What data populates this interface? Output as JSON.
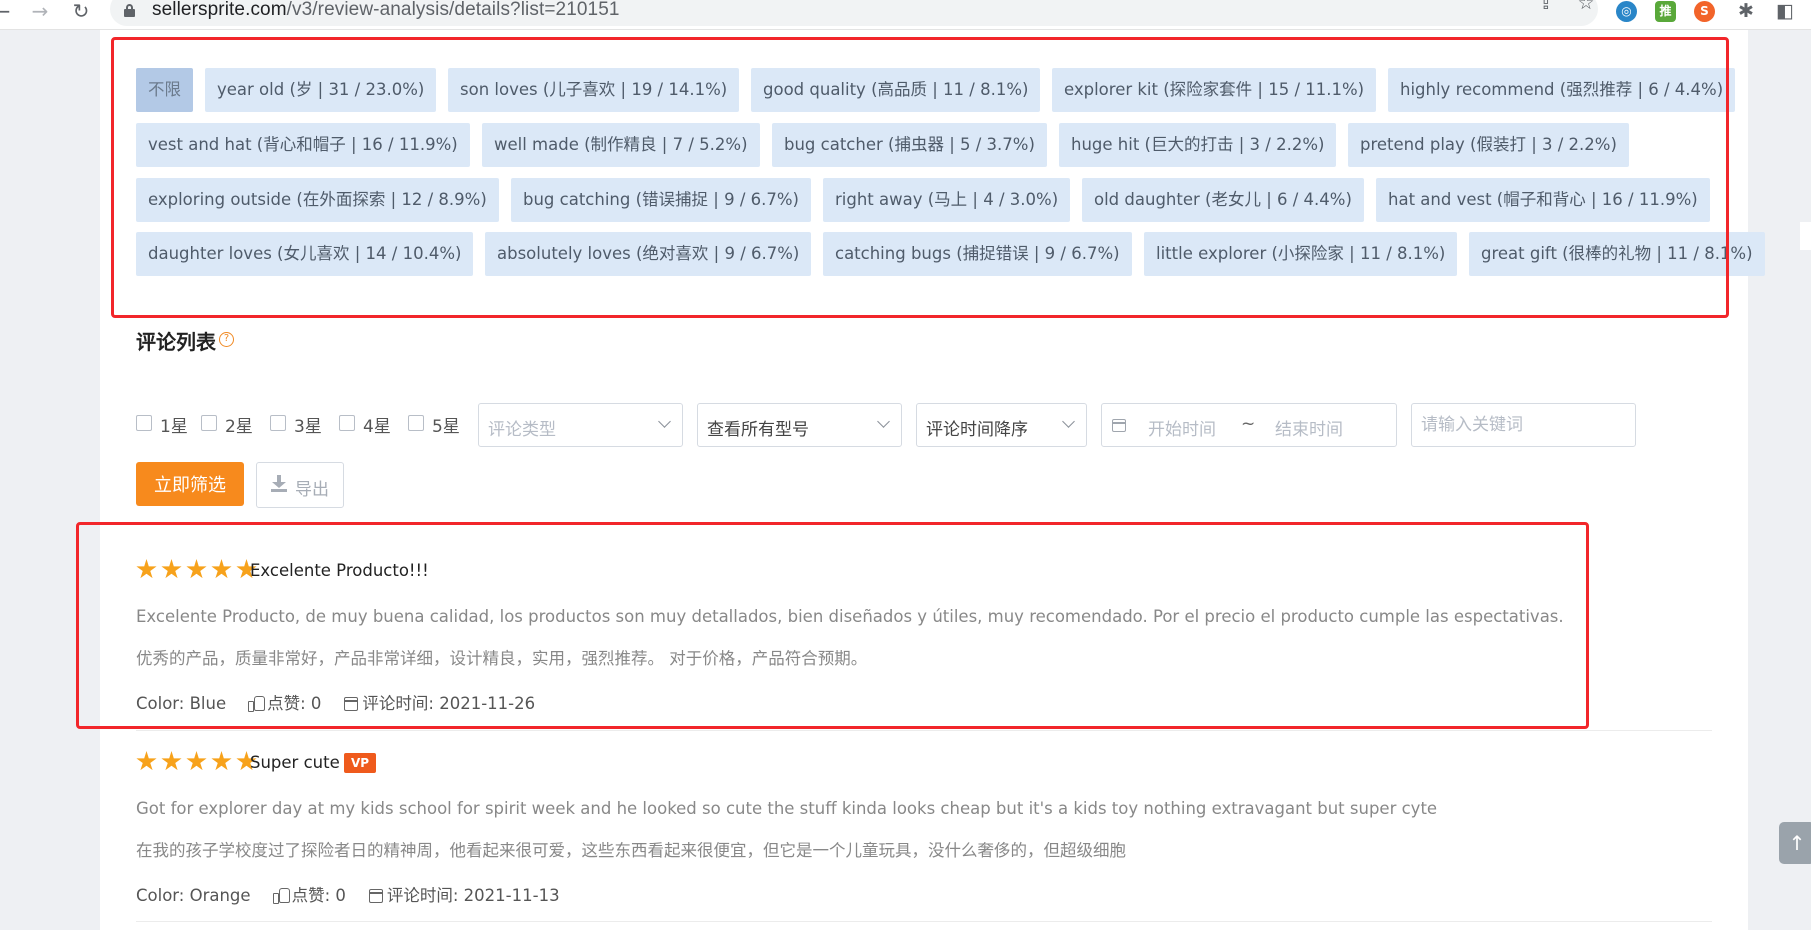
{
  "browser": {
    "url_host": "sellersprite.com",
    "url_path": "/v3/review-analysis/details?list=210151",
    "extensions": [
      {
        "name": "extension-globe-icon",
        "color": "#2a86c8",
        "glyph": "◎"
      },
      {
        "name": "extension-tui-icon",
        "color": "#59a83a",
        "glyph": "推"
      },
      {
        "name": "extension-s-icon",
        "color": "#f2642a",
        "glyph": "S"
      }
    ]
  },
  "keywords": {
    "rows": [
      [
        {
          "label": "不限",
          "active": true
        },
        {
          "label": "year old (岁 | 31 / 23.0%)"
        },
        {
          "label": "son loves (儿子喜欢 | 19 / 14.1%)"
        },
        {
          "label": "good quality (高品质 | 11 / 8.1%)"
        },
        {
          "label": "explorer kit (探险家套件 | 15 / 11.1%)"
        },
        {
          "label": "highly recommend (强烈推荐 | 6 / 4.4%)"
        }
      ],
      [
        {
          "label": "vest and hat (背心和帽子 | 16 / 11.9%)"
        },
        {
          "label": "well made (制作精良 | 7 / 5.2%)"
        },
        {
          "label": "bug catcher (捕虫器 | 5 / 3.7%)"
        },
        {
          "label": "huge hit (巨大的打击 | 3 / 2.2%)"
        },
        {
          "label": "pretend play (假装打 | 3 / 2.2%)"
        }
      ],
      [
        {
          "label": "exploring outside (在外面探索 | 12 / 8.9%)"
        },
        {
          "label": "bug catching (错误捕捉 | 9 / 6.7%)"
        },
        {
          "label": "right away (马上 | 4 / 3.0%)"
        },
        {
          "label": "old daughter (老女儿 | 6 / 4.4%)"
        },
        {
          "label": "hat and vest (帽子和背心 | 16 / 11.9%)"
        }
      ],
      [
        {
          "label": "daughter loves (女儿喜欢 | 14 / 10.4%)"
        },
        {
          "label": "absolutely loves (绝对喜欢 | 9 / 6.7%)"
        },
        {
          "label": "catching bugs (捕捉错误 | 9 / 6.7%)"
        },
        {
          "label": "little explorer (小探险家 | 11 / 8.1%)"
        },
        {
          "label": "great gift (很棒的礼物 | 11 / 8.1%)"
        }
      ]
    ]
  },
  "reviews_section": {
    "title": "评论列表",
    "help_glyph": "?"
  },
  "filters": {
    "stars": [
      "1星",
      "2星",
      "3星",
      "4星",
      "5星"
    ],
    "review_type_placeholder": "评论类型",
    "model_value": "查看所有型号",
    "sort_value": "评论时间降序",
    "start_placeholder": "开始时间",
    "range_sep": "~",
    "end_placeholder": "结束时间",
    "keyword_placeholder": "请输入关键词",
    "filter_button": "立即筛选",
    "export_button": "导出"
  },
  "reviews": [
    {
      "rating": 5,
      "title": "Excelente Producto!!!",
      "vp": false,
      "text": "Excelente Producto, de muy buena calidad, los productos son muy detallados, bien diseñados y útiles, muy recomendado. Por el precio el producto cumple las espectativas.",
      "translation": "优秀的产品，质量非常好，产品非常详细，设计精良，实用，强烈推荐。 对于价格，产品符合预期。",
      "color": "Color: Blue",
      "likes": "点赞: 0",
      "date": "评论时间: 2021-11-26"
    },
    {
      "rating": 5,
      "title": "Super cute",
      "vp": true,
      "vp_label": "VP",
      "text": "Got for explorer day at my kids school for spirit week and he looked so cute the stuff kinda looks cheap but it's a kids toy nothing extravagant but super cyte",
      "translation": "在我的孩子学校度过了探险者日的精神周，他看起来很可爱，这些东西看起来很便宜，但它是一个儿童玩具，没什么奢侈的，但超级细胞",
      "color": "Color: Orange",
      "likes": "点赞: 0",
      "date": "评论时间: 2021-11-13"
    }
  ],
  "colors": {
    "accent": "#f78a1d",
    "annotation_red": "#f2262a",
    "star": "#f7a21b",
    "tag_bg": "#dbe8f7"
  }
}
